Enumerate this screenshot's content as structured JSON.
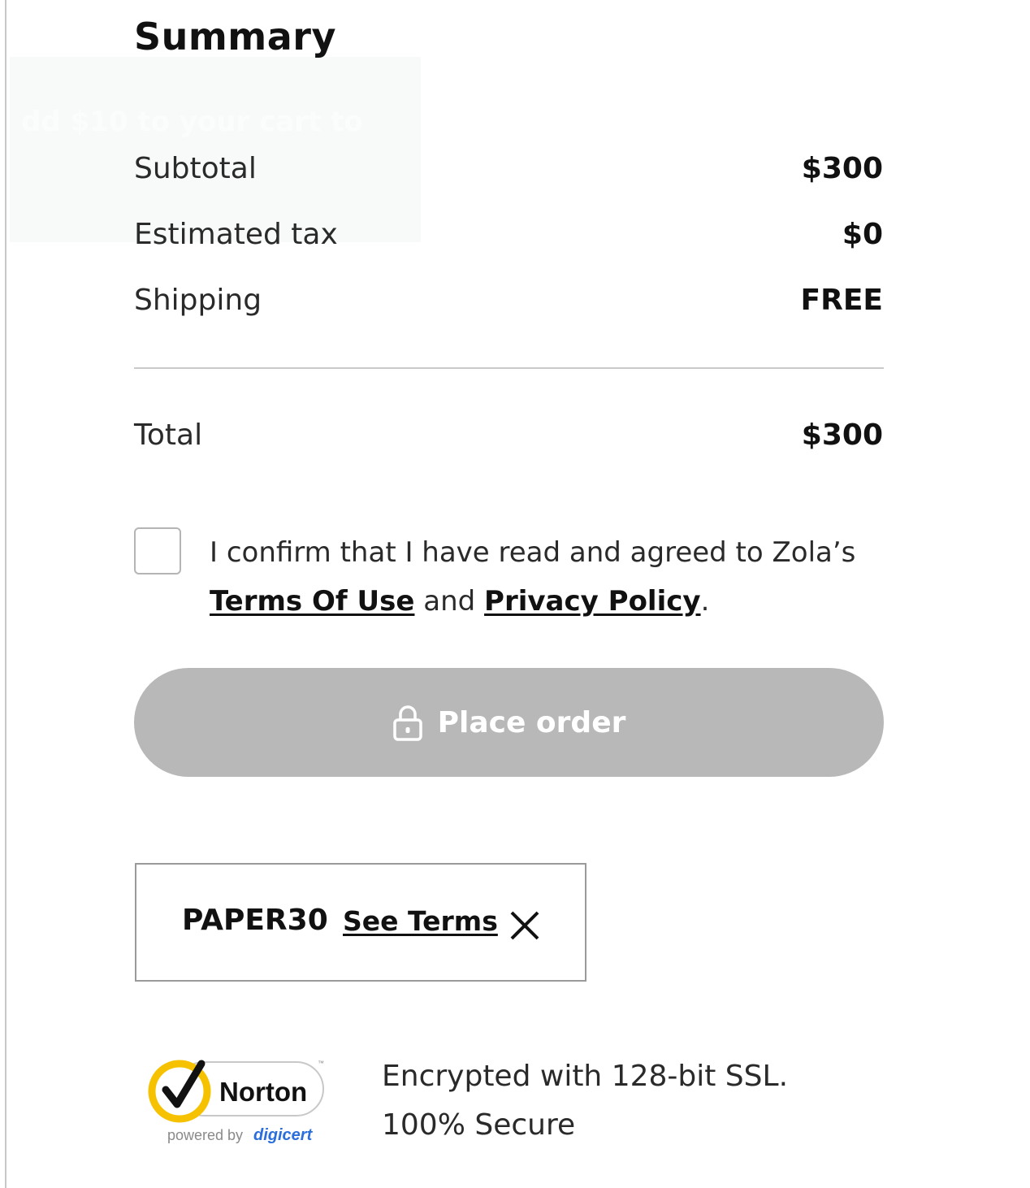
{
  "summary": {
    "title": "Summary",
    "ghost_banner": "dd $10 to your cart to"
  },
  "rows": {
    "subtotal": {
      "label": "Subtotal",
      "value": "$300"
    },
    "tax": {
      "label": "Estimated tax",
      "value": "$0"
    },
    "shipping": {
      "label": "Shipping",
      "value": "FREE"
    },
    "total": {
      "label": "Total",
      "value": "$300"
    }
  },
  "agreement": {
    "line_prefix": "I confirm that I have read and agreed to Zola’s ",
    "terms_link": "Terms Of Use",
    "and_word": " and ",
    "privacy_link": "Privacy Policy",
    "suffix": ".",
    "checked": false
  },
  "place_order": {
    "label": "Place order",
    "icon": "lock-icon",
    "disabled": true,
    "color": "#b8b8b8"
  },
  "promo": {
    "code": "PAPER30",
    "see_terms": "See Terms",
    "remove_icon": "close-icon"
  },
  "security": {
    "badge_brand": "Norton",
    "badge_powered": "powered by",
    "badge_partner": "digicert",
    "line1": "Encrypted with 128-bit SSL.",
    "line2": "100% Secure"
  }
}
